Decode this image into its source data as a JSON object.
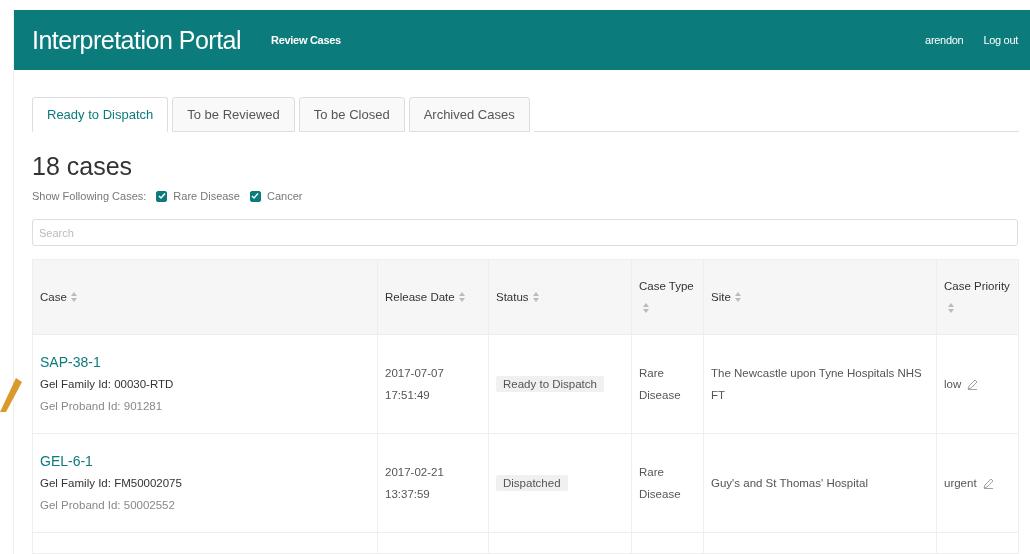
{
  "navbar": {
    "brand": "Interpretation Portal",
    "links": [
      {
        "label": "Review Cases"
      }
    ],
    "user": "arendon",
    "logout": "Log out"
  },
  "tabs": [
    {
      "label": "Ready to Dispatch",
      "selected": true
    },
    {
      "label": "To be Reviewed",
      "selected": false
    },
    {
      "label": "To be Closed",
      "selected": false
    },
    {
      "label": "Archived Cases",
      "selected": false
    }
  ],
  "count_title": "18 cases",
  "filter": {
    "label": "Show Following Cases:",
    "options": [
      {
        "label": "Rare Disease",
        "checked": true
      },
      {
        "label": "Cancer",
        "checked": true
      }
    ]
  },
  "search": {
    "placeholder": "Search"
  },
  "table": {
    "columns": [
      {
        "label": "Case"
      },
      {
        "label": "Release Date"
      },
      {
        "label": "Status"
      },
      {
        "label": "Case Type"
      },
      {
        "label": "Site"
      },
      {
        "label": "Case Priority"
      }
    ],
    "rows": [
      {
        "case": "SAP-38-1",
        "family": "Gel Family Id: 00030-RTD",
        "proband": "Gel Proband Id: 901281",
        "date": "2017-07-07",
        "time": "17:51:49",
        "status": "Ready to Dispatch",
        "type": "Rare Disease",
        "site": "The Newcastle upon Tyne Hospitals NHS FT",
        "priority": "low"
      },
      {
        "case": "GEL-6-1",
        "family": "Gel Family Id: FM50002075",
        "proband": "Gel Proband Id: 50002552",
        "date": "2017-02-21",
        "time": "13:37:59",
        "status": "Dispatched",
        "type": "Rare Disease",
        "site": "Guy's and St Thomas' Hospital",
        "priority": "urgent"
      }
    ]
  }
}
